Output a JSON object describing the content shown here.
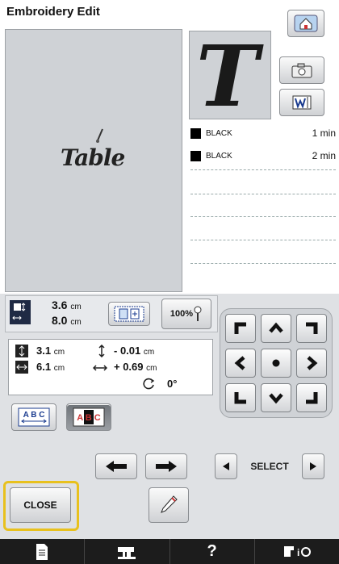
{
  "header": {
    "title": "Embroidery Edit"
  },
  "preview": {
    "text": "Table",
    "thumb_letter": "T"
  },
  "colors": [
    {
      "name": "BLACK",
      "time": "1 min",
      "swatch": "#000000"
    },
    {
      "name": "BLACK",
      "time": "2 min",
      "swatch": "#000000"
    }
  ],
  "size": {
    "width_val": "3.6",
    "height_val": "8.0",
    "unit": "cm"
  },
  "zoom": {
    "label": "100%"
  },
  "measurements": {
    "h_size": "3.1",
    "w_size": "6.1",
    "v_offset": "- 0.01",
    "h_offset": "+ 0.69",
    "rotation": "0°",
    "unit": "cm"
  },
  "select": {
    "label": "SELECT"
  },
  "close": {
    "label": "CLOSE"
  },
  "footer": {
    "help": "?"
  },
  "icons": {
    "home": "home-icon",
    "camera": "camera-icon",
    "scan": "scan-icon",
    "size": "size-icon",
    "frame": "frame-icon",
    "needle": "needle-icon",
    "pen": "pen-icon",
    "doc": "document-icon",
    "sewing": "sewing-machine-icon",
    "settings": "machine-settings-icon"
  }
}
